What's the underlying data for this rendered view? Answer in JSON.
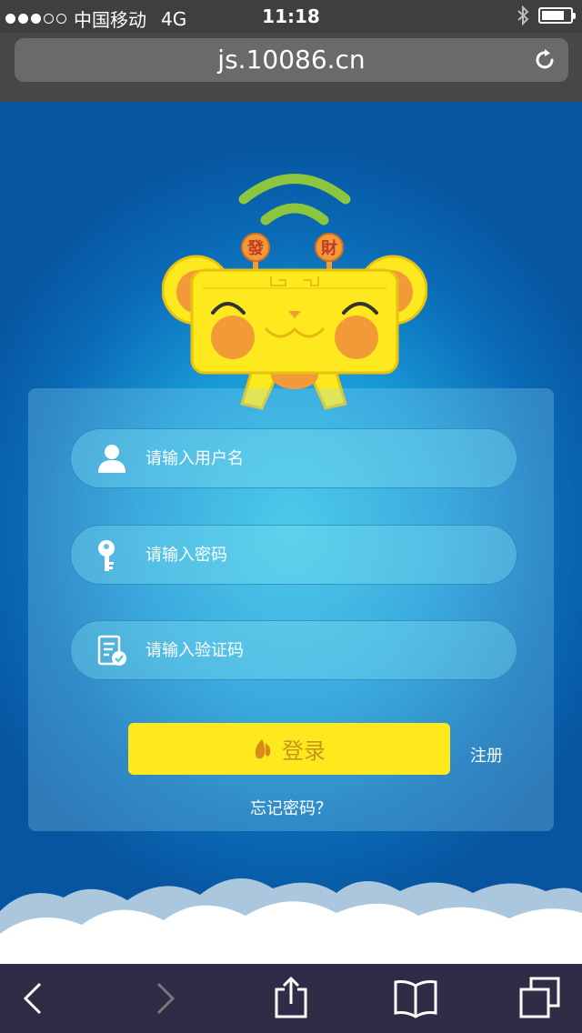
{
  "status_bar": {
    "carrier": "中国移动",
    "network": "4G",
    "time": "11:18",
    "signal_bars_filled": 3,
    "signal_bars_total": 5
  },
  "browser": {
    "url": "js.10086.cn"
  },
  "mascot": {
    "badge_left": "發",
    "badge_right": "財"
  },
  "form": {
    "username_placeholder": "请输入用户名",
    "password_placeholder": "请输入密码",
    "captcha_placeholder": "请输入验证码",
    "login_label": "登录",
    "register_label": "注册",
    "forgot_label": "忘记密码？"
  },
  "icons": {
    "status": [
      "signal-dots-icon",
      "bluetooth-icon",
      "battery-icon"
    ],
    "browser": [
      "reload-icon"
    ],
    "form": [
      "user-icon",
      "key-icon",
      "verify-document-icon",
      "leaf-icon"
    ],
    "toolbar": [
      "back-icon",
      "forward-icon",
      "share-icon",
      "bookmarks-icon",
      "tabs-icon"
    ]
  },
  "colors": {
    "login_button": "#fde91d",
    "login_text": "#c8961c",
    "background_dark": "#0755a0",
    "background_glow": "#2fc4e6",
    "wifi_arc": "#8cc63f",
    "mascot_body": "#fde91d",
    "mascot_cheek": "#f29a38"
  }
}
